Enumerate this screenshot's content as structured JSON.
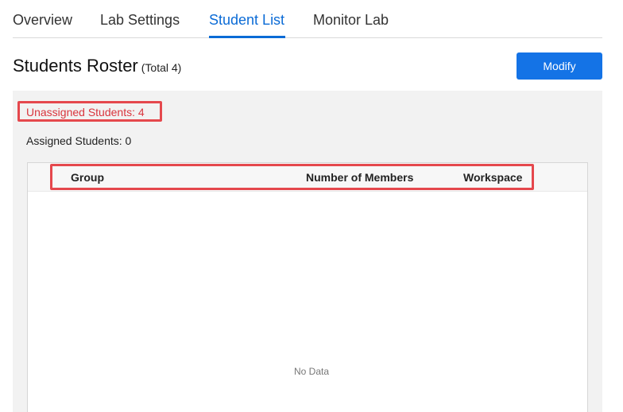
{
  "tabs": [
    {
      "label": "Overview"
    },
    {
      "label": "Lab Settings"
    },
    {
      "label": "Student List",
      "active": true
    },
    {
      "label": "Monitor Lab"
    }
  ],
  "roster": {
    "title": "Students Roster",
    "total": "(Total 4)",
    "modify_label": "Modify",
    "unassigned": "Unassigned Students: 4",
    "assigned": "Assigned Students: 0"
  },
  "table": {
    "columns": [
      "Group",
      "Number of Members",
      "Workspace"
    ],
    "empty_text": "No Data"
  },
  "colors": {
    "accent": "#1473e6",
    "highlight_border": "#e5484d",
    "unassigned_text": "#d9363e"
  }
}
